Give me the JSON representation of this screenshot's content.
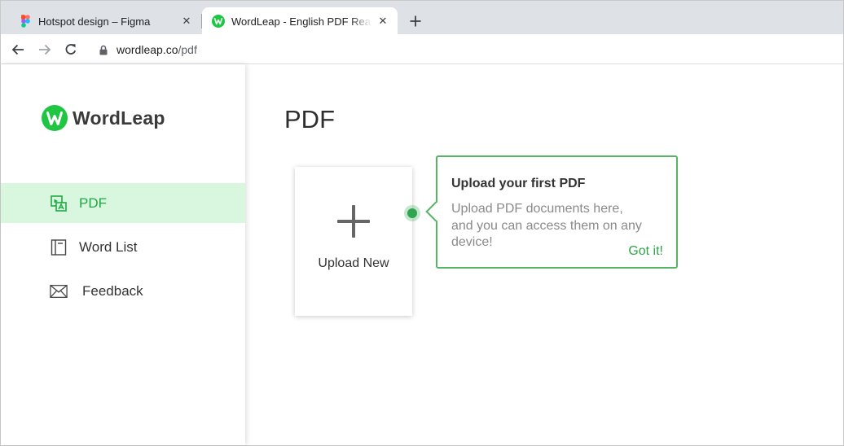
{
  "browser": {
    "tabs": [
      {
        "title": "Hotspot design – Figma",
        "icon": "figma-icon",
        "active": false
      },
      {
        "title": "WordLeap - English PDF Reading",
        "icon": "wordleap-icon",
        "active": true
      }
    ],
    "url_host": "wordleap.co",
    "url_path": "/pdf"
  },
  "sidebar": {
    "logo_text": "WordLeap",
    "items": [
      {
        "label": "PDF",
        "icon": "pdf-icon",
        "active": true
      },
      {
        "label": "Word List",
        "icon": "book-icon",
        "active": false
      },
      {
        "label": "Feedback",
        "icon": "envelope-icon",
        "active": false
      }
    ]
  },
  "main": {
    "title": "PDF",
    "upload_label": "Upload New"
  },
  "tooltip": {
    "title": "Upload your first PDF",
    "body": "Upload PDF documents here, and you can access them on any device!",
    "action": "Got it!"
  },
  "colors": {
    "brand_green": "#1ec641",
    "active_bg": "#d8f7de",
    "active_text": "#1fa944",
    "tooltip_border": "#57b463"
  }
}
